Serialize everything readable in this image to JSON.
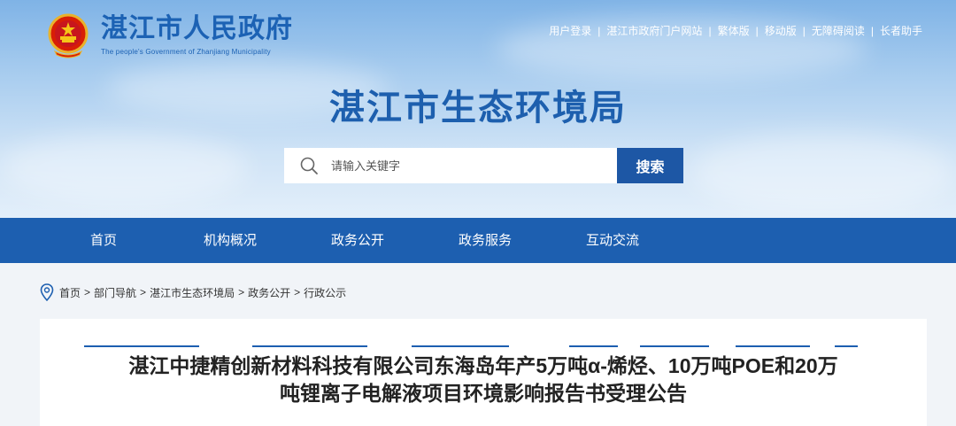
{
  "header": {
    "site_name": "湛江市人民政府",
    "site_name_en": "The people's Government of Zhanjiang Municipality",
    "emblem_icon": "national-emblem-icon",
    "top_links": [
      "用户登录",
      "湛江市政府门户网站",
      "繁体版",
      "移动版",
      "无障碍阅读",
      "长者助手"
    ],
    "separator": "|",
    "bureau_title": "湛江市生态环境局"
  },
  "search": {
    "placeholder": "请输入关键字",
    "button_label": "搜索",
    "icon": "search-icon"
  },
  "nav": {
    "items": [
      "首页",
      "机构概况",
      "政务公开",
      "政务服务",
      "互动交流"
    ]
  },
  "breadcrumb": {
    "icon": "location-pin-icon",
    "items": [
      "首页",
      "部门导航",
      "湛江市生态环境局",
      "政务公开",
      "行政公示"
    ],
    "separator": ">"
  },
  "article": {
    "title": "湛江中捷精创新材料科技有限公司东海岛年产5万吨α-烯烃、10万吨POE和20万吨锂离子电解液项目环境影响报告书受理公告"
  },
  "colors": {
    "primary_blue": "#1d5fb0",
    "title_blue": "#1d5fae",
    "search_button": "#1d57a5",
    "content_bg": "#f1f4f8"
  }
}
